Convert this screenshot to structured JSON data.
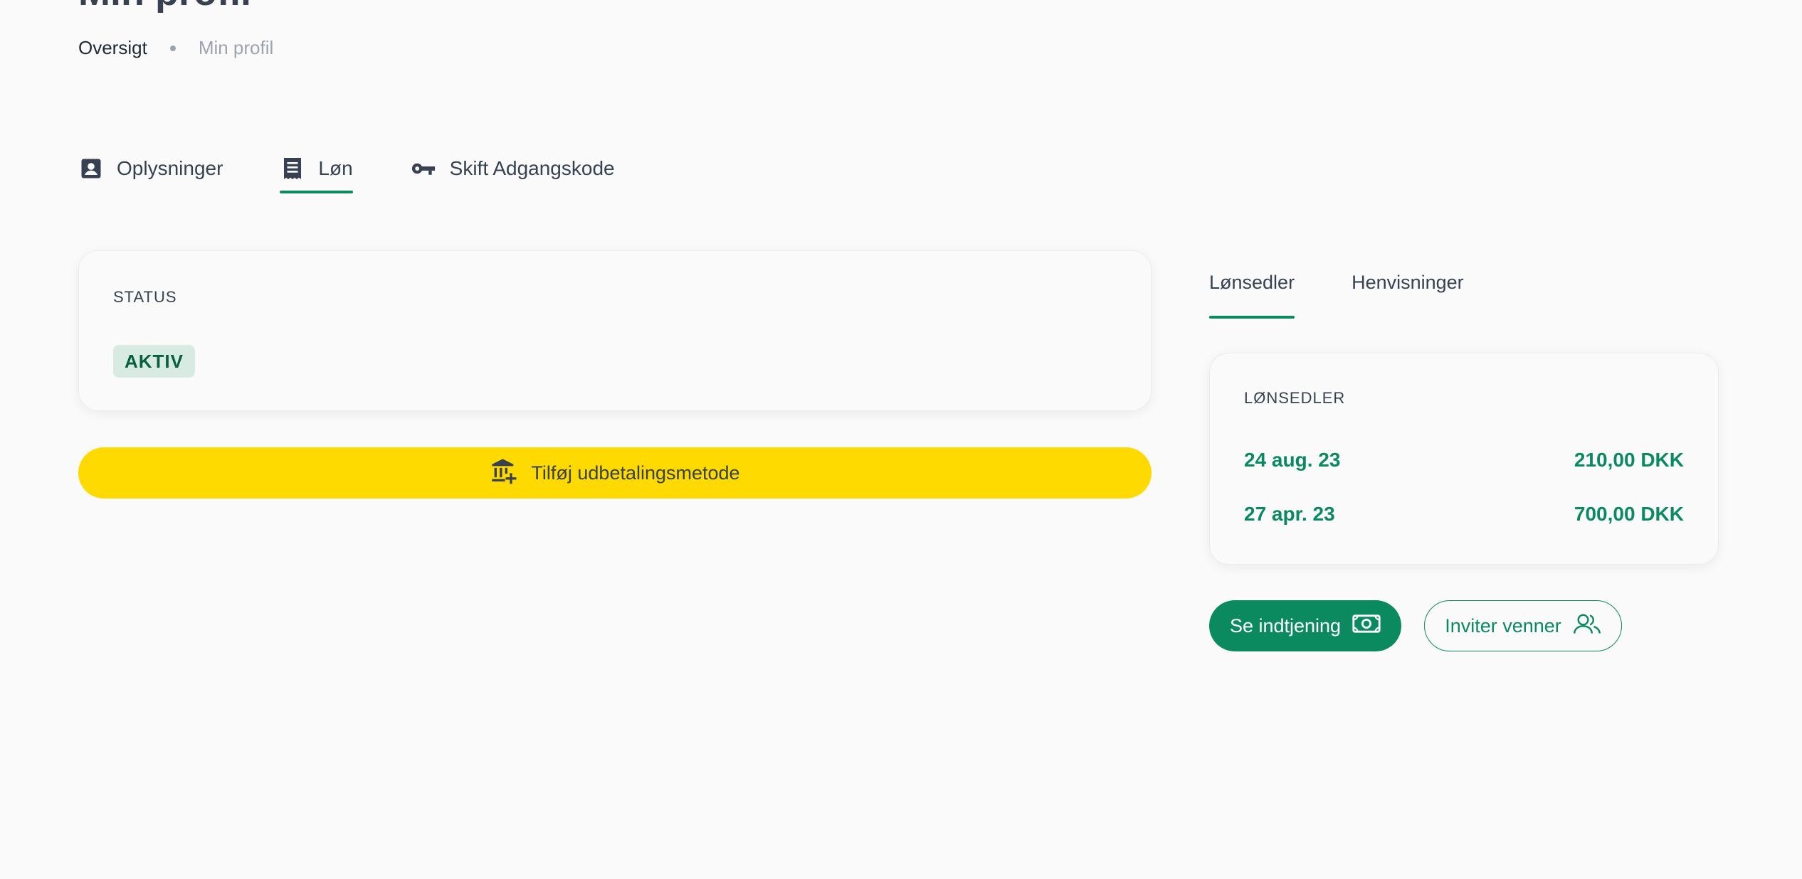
{
  "header": {
    "title": "Min profil",
    "breadcrumb": [
      "Oversigt",
      "Min profil"
    ]
  },
  "main_tabs": [
    {
      "label": "Oplysninger",
      "icon": "contact-card-icon"
    },
    {
      "label": "Løn",
      "icon": "receipt-icon",
      "active": true
    },
    {
      "label": "Skift Adgangskode",
      "icon": "key-icon"
    }
  ],
  "status_card": {
    "label": "STATUS",
    "value": "AKTIV"
  },
  "add_payout_button": {
    "label": "Tilføj udbetalingsmetode",
    "icon": "bank-add-icon"
  },
  "sub_tabs": [
    {
      "label": "Lønsedler",
      "active": true
    },
    {
      "label": "Henvisninger"
    }
  ],
  "payslips": {
    "title": "LØNSEDLER",
    "rows": [
      {
        "date": "24 aug. 23",
        "amount": "210,00 DKK"
      },
      {
        "date": "27 apr. 23",
        "amount": "700,00 DKK"
      }
    ]
  },
  "actions": {
    "earnings_label": "Se indtjening",
    "earnings_icon": "cash-icon",
    "invite_label": "Inviter venner",
    "invite_icon": "users-icon"
  },
  "colors": {
    "accent": "#0b8a5f",
    "yellow": "#ffda00",
    "badge_bg": "#d7ebe2",
    "text": "#374151",
    "muted": "#9ca3af",
    "background": "#fafafa"
  }
}
